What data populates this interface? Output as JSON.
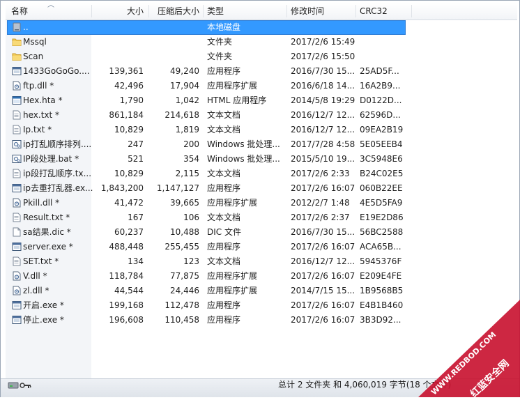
{
  "columns": {
    "name": "名称",
    "size": "大小",
    "packed": "压缩后大小",
    "type": "类型",
    "modified": "修改时间",
    "crc": "CRC32"
  },
  "rows": [
    {
      "name": "..",
      "size": "",
      "packed": "",
      "type": "本地磁盘",
      "modified": "",
      "crc": "",
      "icon": "drive-icon",
      "selected": true
    },
    {
      "name": "Mssql",
      "size": "",
      "packed": "",
      "type": "文件夹",
      "modified": "2017/2/6 15:49",
      "crc": "",
      "icon": "folder-icon"
    },
    {
      "name": "Scan",
      "size": "",
      "packed": "",
      "type": "文件夹",
      "modified": "2017/2/6 15:50",
      "crc": "",
      "icon": "folder-icon"
    },
    {
      "name": "1433GoGoGo....",
      "size": "139,361",
      "packed": "49,240",
      "type": "应用程序",
      "modified": "2016/7/30 15...",
      "crc": "25AD5F...",
      "icon": "exe-icon"
    },
    {
      "name": "ftp.dll *",
      "size": "42,496",
      "packed": "17,904",
      "type": "应用程序扩展",
      "modified": "2016/6/18 14...",
      "crc": "16A2B9...",
      "icon": "dll-icon"
    },
    {
      "name": "Hex.hta *",
      "size": "1,790",
      "packed": "1,042",
      "type": "HTML 应用程序",
      "modified": "2014/5/8 19:29",
      "crc": "D0122D...",
      "icon": "hta-icon"
    },
    {
      "name": "hex.txt *",
      "size": "861,184",
      "packed": "214,618",
      "type": "文本文档",
      "modified": "2016/12/7 12...",
      "crc": "62596D...",
      "icon": "txt-icon"
    },
    {
      "name": "Ip.txt *",
      "size": "10,829",
      "packed": "1,819",
      "type": "文本文档",
      "modified": "2016/12/7 12...",
      "crc": "09EA2B19",
      "icon": "txt-icon"
    },
    {
      "name": "ip打乱顺序排列....",
      "size": "247",
      "packed": "200",
      "type": "Windows 批处理...",
      "modified": "2017/7/28 4:58",
      "crc": "5E05EEB4",
      "icon": "bat-icon"
    },
    {
      "name": "IP段处理.bat *",
      "size": "521",
      "packed": "354",
      "type": "Windows 批处理...",
      "modified": "2015/5/10 19...",
      "crc": "3C5948E6",
      "icon": "bat-icon"
    },
    {
      "name": "ip段打乱顺序.tx...",
      "size": "10,829",
      "packed": "2,115",
      "type": "文本文档",
      "modified": "2017/2/6 2:33",
      "crc": "B24C02E5",
      "icon": "txt-icon"
    },
    {
      "name": "ip去重打乱器.ex...",
      "size": "1,843,200",
      "packed": "1,147,127",
      "type": "应用程序",
      "modified": "2017/2/6 16:07",
      "crc": "060B22EE",
      "icon": "exe-icon"
    },
    {
      "name": "Pkill.dll *",
      "size": "41,472",
      "packed": "39,665",
      "type": "应用程序扩展",
      "modified": "2012/2/7 1:48",
      "crc": "4E5D5FA9",
      "icon": "dll-icon"
    },
    {
      "name": "Result.txt *",
      "size": "167",
      "packed": "106",
      "type": "文本文档",
      "modified": "2017/2/6 2:37",
      "crc": "E19E2D86",
      "icon": "txt-icon"
    },
    {
      "name": "sa结果.dic *",
      "size": "60,237",
      "packed": "10,488",
      "type": "DIC 文件",
      "modified": "2016/7/30 15...",
      "crc": "56BC2588",
      "icon": "file-icon"
    },
    {
      "name": "server.exe *",
      "size": "488,448",
      "packed": "255,455",
      "type": "应用程序",
      "modified": "2017/2/6 16:07",
      "crc": "ACA65B...",
      "icon": "exe-icon"
    },
    {
      "name": "SET.txt *",
      "size": "134",
      "packed": "123",
      "type": "文本文档",
      "modified": "2016/12/7 12...",
      "crc": "5945376F",
      "icon": "txt-icon"
    },
    {
      "name": "V.dll *",
      "size": "118,784",
      "packed": "77,875",
      "type": "应用程序扩展",
      "modified": "2017/2/6 16:07",
      "crc": "E209E4FE",
      "icon": "dll-icon"
    },
    {
      "name": "zl.dll *",
      "size": "44,544",
      "packed": "24,446",
      "type": "应用程序扩展",
      "modified": "2014/7/15 15...",
      "crc": "1B9568B5",
      "icon": "dll-icon"
    },
    {
      "name": "开启.exe *",
      "size": "199,168",
      "packed": "112,478",
      "type": "应用程序",
      "modified": "2017/2/6 16:07",
      "crc": "E4B1B460",
      "icon": "exe-icon"
    },
    {
      "name": "停止.exe *",
      "size": "196,608",
      "packed": "110,458",
      "type": "应用程序",
      "modified": "2017/2/6 16:07",
      "crc": "3B3D92...",
      "icon": "exe-icon"
    }
  ],
  "status": {
    "text": "总计 2 文件夹 和 4,060,019 字节(18 个文件)"
  },
  "watermark": {
    "line1": "WWW.REDBOD.COM",
    "line2": "红蓝安全网"
  },
  "colors": {
    "selection": "#3399ff",
    "watermark": "#c8102e"
  }
}
